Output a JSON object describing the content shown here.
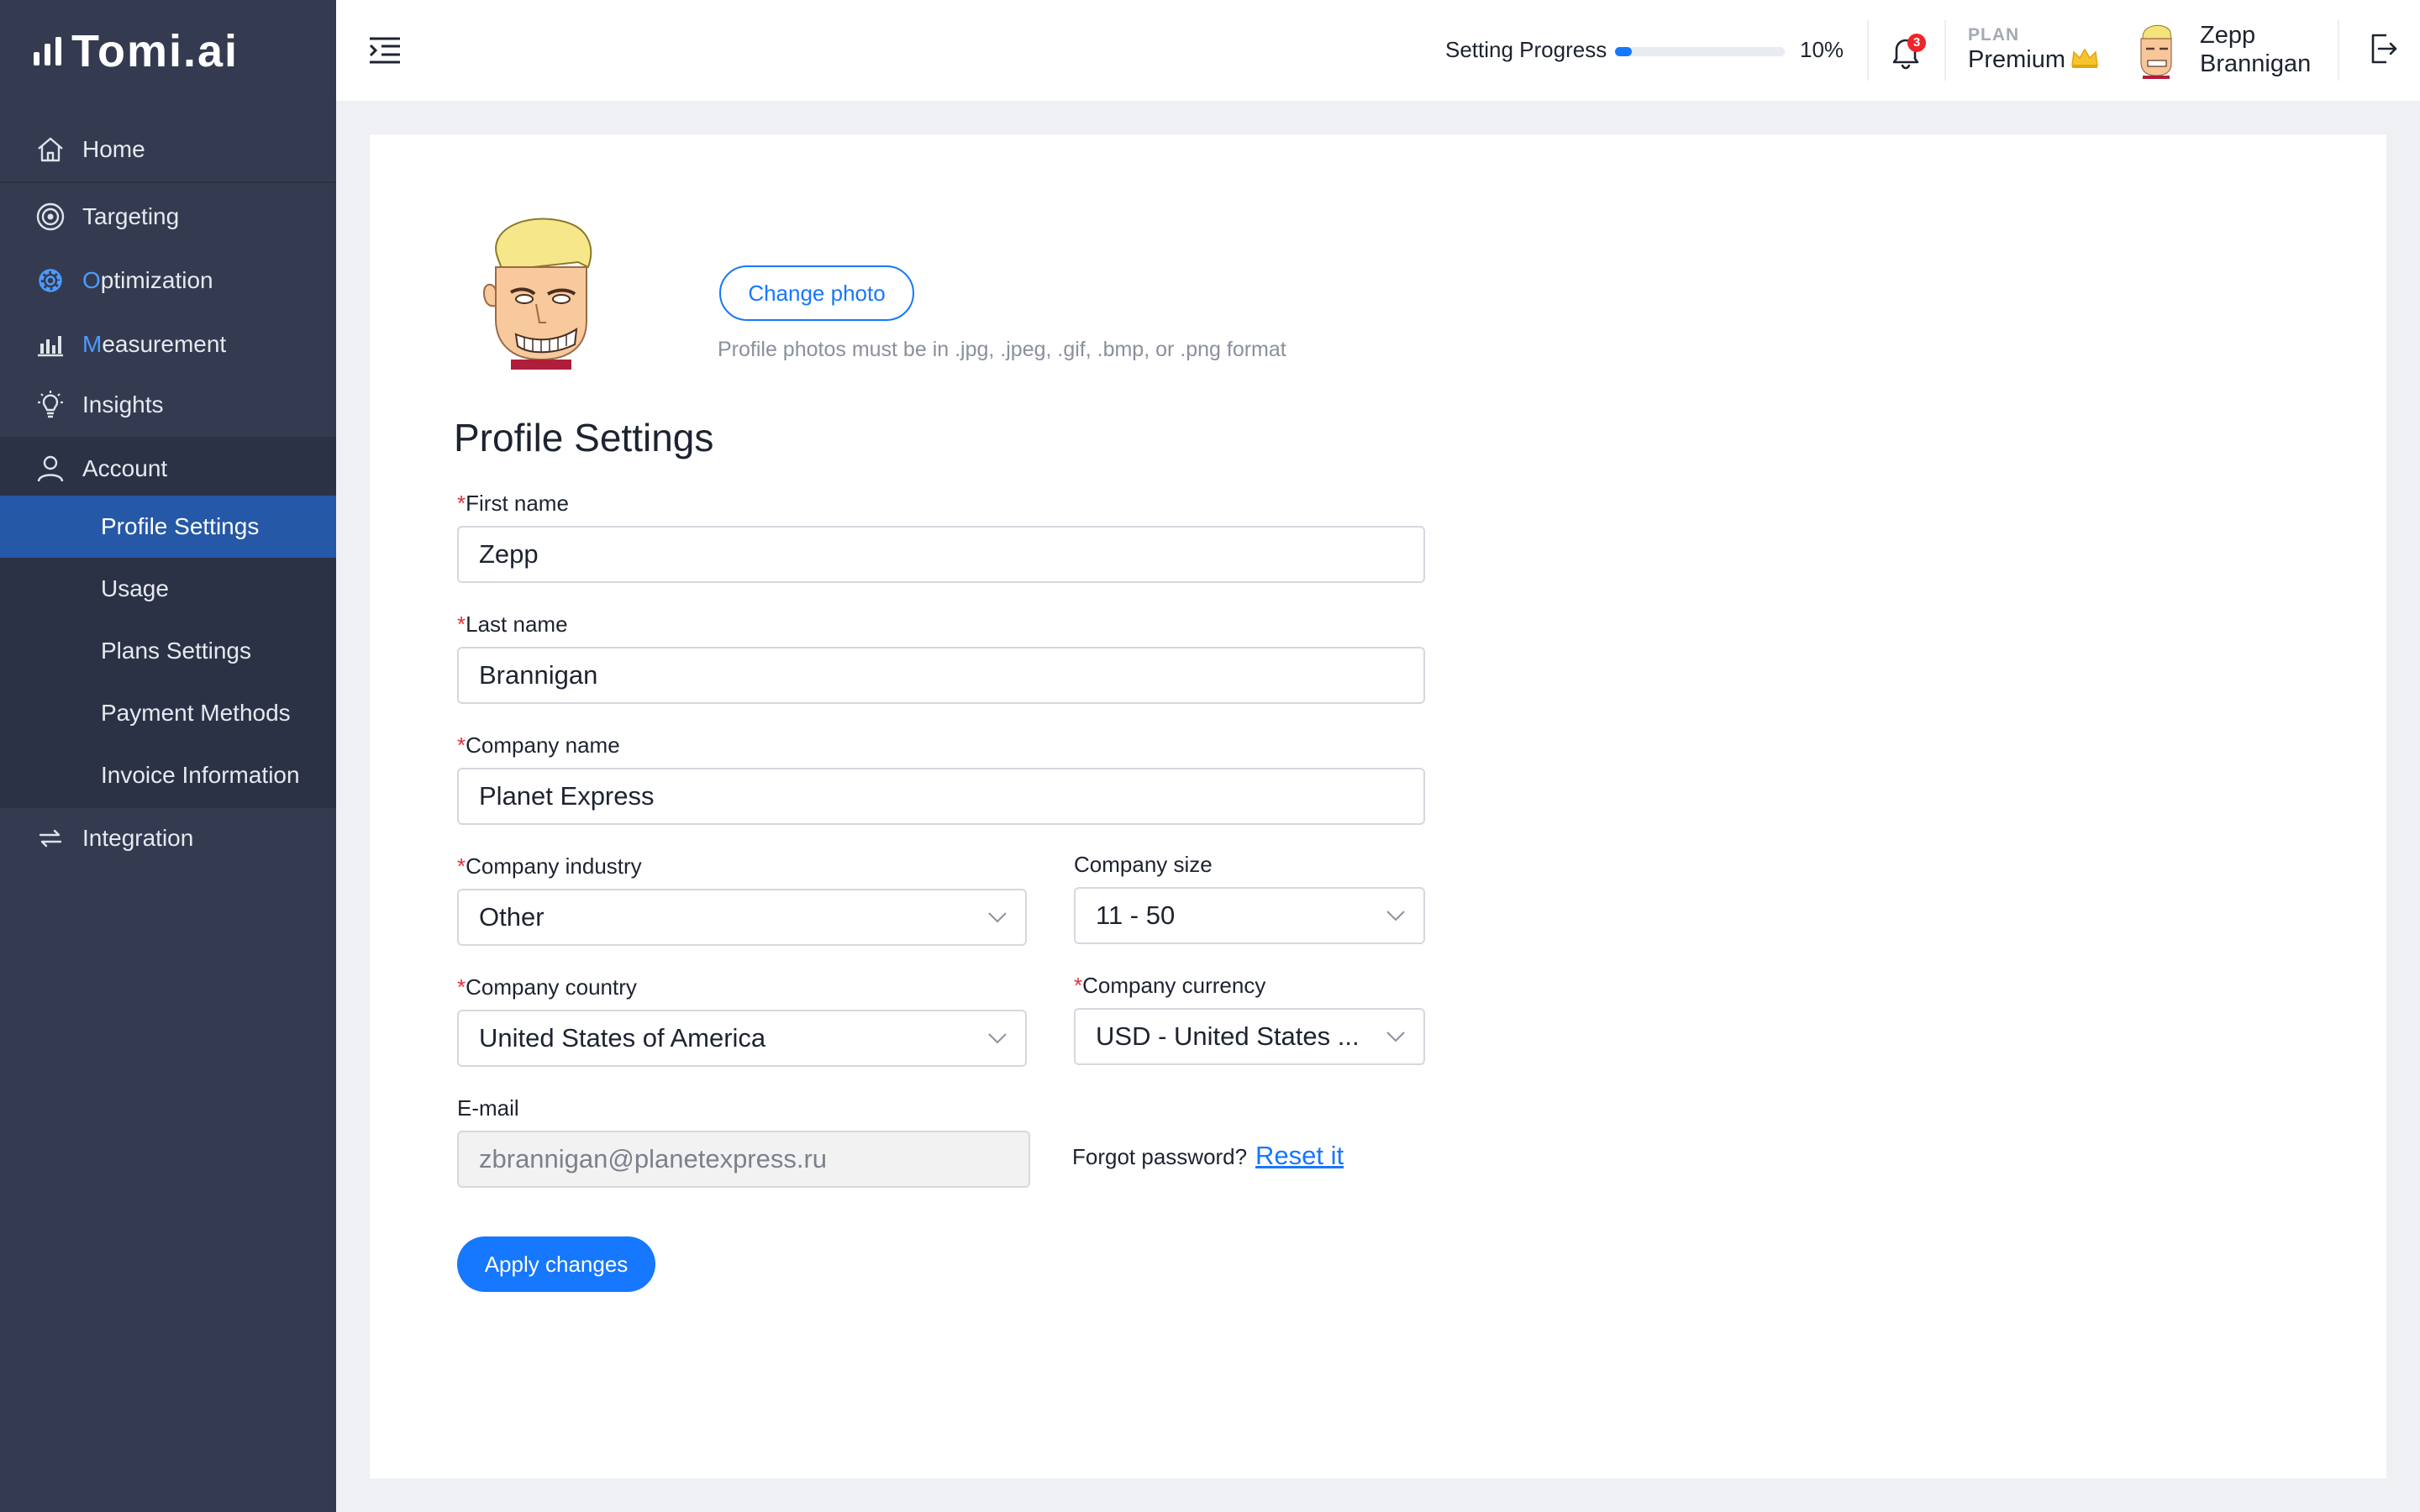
{
  "brand": {
    "name": "Tomi.ai"
  },
  "sidebar": {
    "items": [
      {
        "label": "Home",
        "icon": "home-icon"
      },
      {
        "label": "Targeting",
        "icon": "target-icon"
      },
      {
        "label_first": "O",
        "label_rest": "ptimization",
        "icon": "gear-icon"
      },
      {
        "label_first": "M",
        "label_rest": "easurement",
        "icon": "bar-chart-icon"
      },
      {
        "label": "Insights",
        "icon": "lightbulb-icon"
      },
      {
        "label": "Account",
        "icon": "user-icon"
      },
      {
        "label": "Integration",
        "icon": "sync-icon"
      }
    ],
    "account_sub": [
      {
        "label": "Profile Settings",
        "selected": true
      },
      {
        "label": "Usage"
      },
      {
        "label": "Plans Settings"
      },
      {
        "label": "Payment Methods"
      },
      {
        "label": "Invoice Information"
      }
    ]
  },
  "header": {
    "progress_label": "Setting Progress",
    "progress_value": 10,
    "progress_text": "10%",
    "notification_count": "3",
    "plan_caption": "PLAN",
    "plan_name": "Premium",
    "user_first": "Zepp",
    "user_last": "Brannigan"
  },
  "profile": {
    "change_photo_label": "Change photo",
    "photo_note": "Profile photos must be in .jpg, .jpeg, .gif, .bmp, or .png format",
    "title": "Profile Settings",
    "required_mark": "*",
    "first_name_label": "First name",
    "first_name": "Zepp",
    "last_name_label": "Last name",
    "last_name": "Brannigan",
    "company_name_label": "Company name",
    "company_name": "Planet Express",
    "industry_label": "Company industry",
    "industry": "Other",
    "size_label": "Company size",
    "size": "11 - 50",
    "country_label": "Company country",
    "country": "United States of America",
    "currency_label": "Company currency",
    "currency": "USD - United States ...",
    "email_label": "E-mail",
    "email": "zbrannigan@planetexpress.ru",
    "forgot_label": "Forgot password?",
    "reset_label": "Reset it",
    "apply_label": "Apply changes"
  },
  "colors": {
    "sidebar_bg": "#343b50",
    "sidebar_selected": "#2558a6",
    "accent": "#1677ff",
    "required": "#e0303a"
  }
}
